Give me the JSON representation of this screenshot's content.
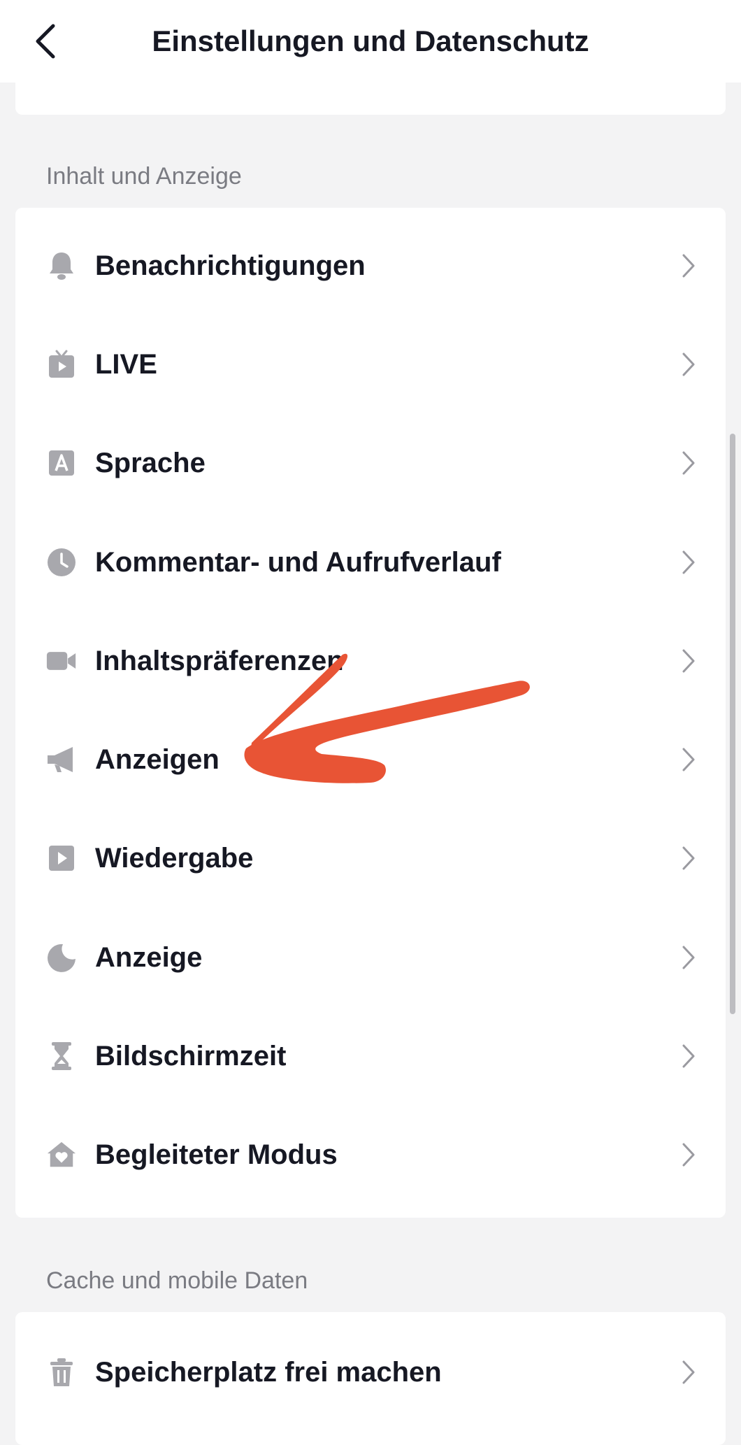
{
  "header": {
    "title": "Einstellungen und Datenschutz",
    "back_icon": "chevron-left-icon"
  },
  "sections": [
    {
      "label": "Inhalt und Anzeige",
      "items": [
        {
          "label": "Benachrichtigungen",
          "icon": "bell-icon"
        },
        {
          "label": "LIVE",
          "icon": "live-tv-icon"
        },
        {
          "label": "Sprache",
          "icon": "language-icon"
        },
        {
          "label": "Kommentar- und Aufrufverlauf",
          "icon": "clock-icon"
        },
        {
          "label": "Inhaltspräferenzen",
          "icon": "video-camera-icon"
        },
        {
          "label": "Anzeigen",
          "icon": "megaphone-icon"
        },
        {
          "label": "Wiedergabe",
          "icon": "play-icon"
        },
        {
          "label": "Anzeige",
          "icon": "moon-icon"
        },
        {
          "label": "Bildschirmzeit",
          "icon": "hourglass-icon"
        },
        {
          "label": "Begleiteter Modus",
          "icon": "home-heart-icon"
        }
      ]
    },
    {
      "label": "Cache und mobile Daten",
      "items": [
        {
          "label": "Speicherplatz frei machen",
          "icon": "trash-icon"
        }
      ]
    }
  ],
  "colors": {
    "background": "#f3f3f4",
    "card": "#ffffff",
    "text": "#161823",
    "section_label": "#7a7b82",
    "icon": "#a8a8ad",
    "chevron": "#9a9aa0",
    "annotation_arrow": "#e85435"
  }
}
